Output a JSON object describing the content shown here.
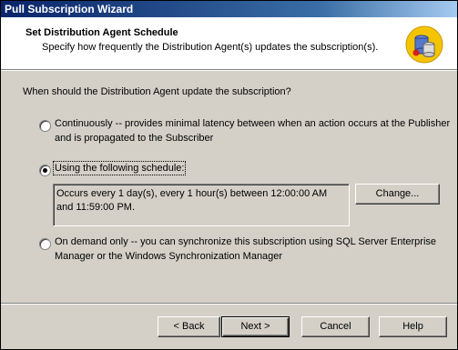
{
  "window": {
    "title": "Pull Subscription Wizard"
  },
  "header": {
    "title": "Set Distribution Agent Schedule",
    "subtitle": "Specify how frequently the Distribution Agent(s) updates the subscription(s).",
    "icon": "database-wizard-icon"
  },
  "question": "When should the Distribution Agent update the subscription?",
  "options": [
    {
      "line1": "Continuously -- provides minimal latency between when an action occurs at the Publisher",
      "line2": "and is propagated to the Subscriber",
      "selected": false
    },
    {
      "label": "Using the following schedule:",
      "selected": true
    },
    {
      "line1": "On demand only -- you can synchronize this subscription using SQL Server Enterprise",
      "line2": "Manager or the Windows Synchronization Manager",
      "selected": false
    }
  ],
  "schedule": {
    "text": "Occurs every 1 day(s), every 1 hour(s) between 12:00:00 AM and 11:59:00 PM.",
    "change_label": "Change..."
  },
  "buttons": {
    "back": "< Back",
    "next": "Next >",
    "cancel": "Cancel",
    "help": "Help"
  }
}
